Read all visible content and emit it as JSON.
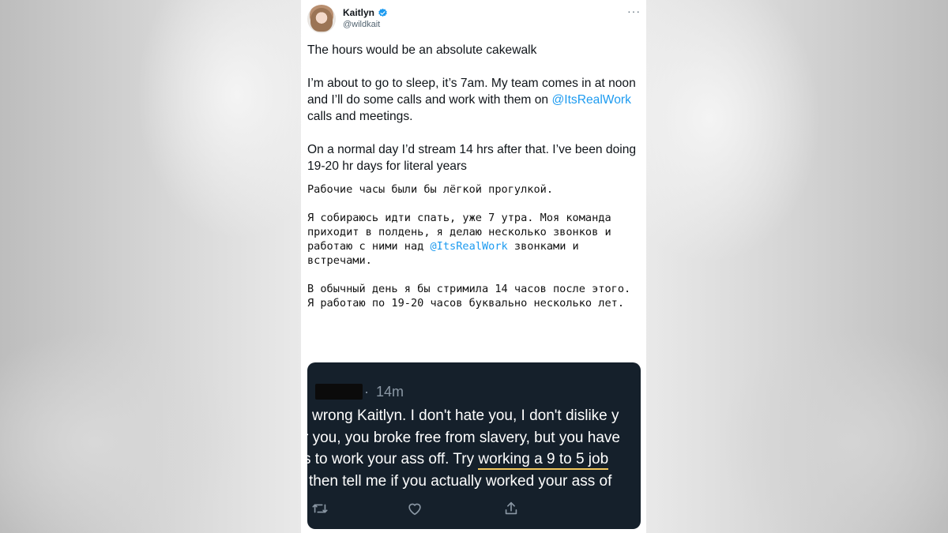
{
  "tweet": {
    "display_name": "Kaitlyn",
    "handle": "@wildkait",
    "more_icon": "more-icon",
    "english": {
      "p1": "The hours would be an absolute cakewalk",
      "p2_before": "I’m about to go to sleep, it’s 7am.  My team comes in at noon and I’ll do some calls and work with them on ",
      "p2_mention": "@ItsRealWork",
      "p2_after": " calls and meetings.",
      "p3": "On a normal day I’d stream 14 hrs after that.  I’ve been doing 19-20 hr days for literal years"
    },
    "russian": {
      "p1": "Рабочие часы были бы лёгкой прогулкой.",
      "p2_before": "Я собираюсь идти спать, уже 7 утра. Моя команда приходит в полдень, я делаю несколько звонков и работаю с ними над ",
      "p2_mention": "@ItsRealWork",
      "p2_after": " звонками и встречами.",
      "p3": "В обычный день я бы стримила 14 часов после этого. Я работаю по 19-20 часов буквально несколько лет."
    }
  },
  "embedded_reply": {
    "dot": "·",
    "time": "14m",
    "line1": "wrong Kaitlyn. I don't hate you, I don't dislike y",
    "line2": "r you, you broke free from slavery, but you have",
    "line3_before": "s to work your ass off. Try ",
    "line3_highlight": "working a 9 to 5 job",
    "line4": " then tell me if you actually worked your ass of",
    "actions": [
      "retweet-icon",
      "like-icon",
      "share-icon"
    ]
  },
  "colors": {
    "mention": "#1d9bf0",
    "embed_background": "#15202b",
    "highlight_underline": "#f2c75c",
    "verified": "#1d9bf0"
  }
}
